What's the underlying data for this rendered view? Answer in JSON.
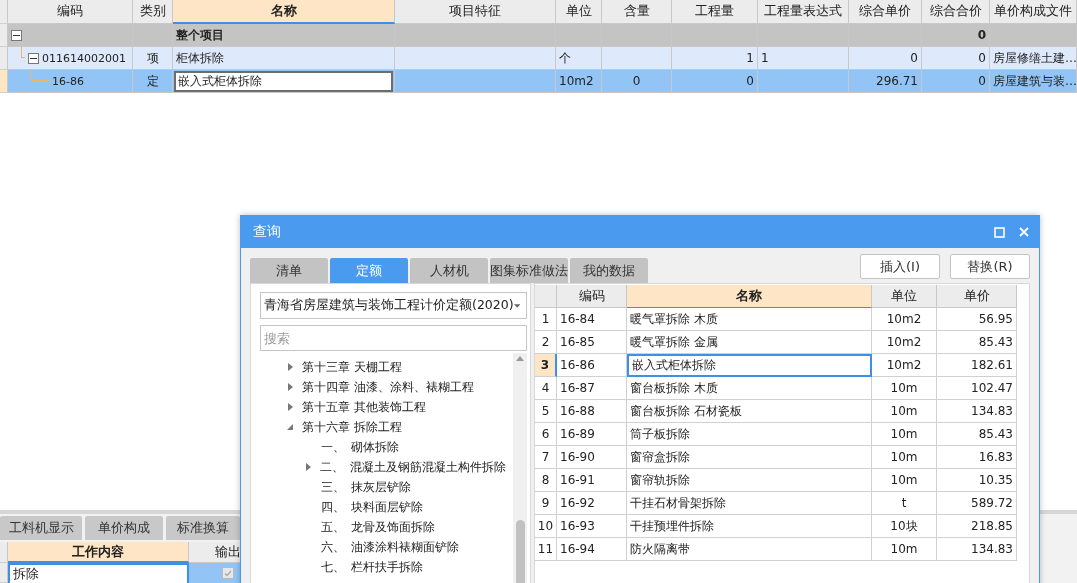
{
  "main_table": {
    "columns": [
      {
        "label": "编码",
        "selected": false
      },
      {
        "label": "类别",
        "selected": false
      },
      {
        "label": "名称",
        "selected": true
      },
      {
        "label": "项目特征",
        "selected": false
      },
      {
        "label": "单位",
        "selected": false
      },
      {
        "label": "含量",
        "selected": false
      },
      {
        "label": "工程量",
        "selected": false
      },
      {
        "label": "工程量表达式",
        "selected": false
      },
      {
        "label": "综合单价",
        "selected": false
      },
      {
        "label": "综合合价",
        "selected": false
      },
      {
        "label": "单价构成文件",
        "selected": false
      }
    ],
    "rows": [
      {
        "kind": "project",
        "expanded": true,
        "selected": false,
        "cells": [
          null,
          null,
          "整个项目",
          null,
          null,
          null,
          null,
          null,
          null,
          "0",
          null
        ],
        "children": [
          {
            "kind": "item",
            "expanded": true,
            "selected": false,
            "cells": [
              "011614002001",
              "项",
              "柜体拆除",
              null,
              "个",
              null,
              "1",
              "1",
              "0",
              "0",
              "房屋修缮土建…"
            ],
            "children": [
              {
                "kind": "quota",
                "selected": true,
                "cells": [
                  "16-86",
                  "定",
                  "嵌入式柜体拆除",
                  null,
                  "10m2",
                  "0",
                  "0",
                  null,
                  "296.71",
                  "0",
                  "房屋建筑与装…"
                ]
              }
            ]
          }
        ]
      }
    ]
  },
  "bottom_panel": {
    "tabs": [
      {
        "label": "工料机显示"
      },
      {
        "label": "单价构成"
      },
      {
        "label": "标准换算"
      }
    ],
    "columns": [
      {
        "label": "工作内容",
        "selected": true
      },
      {
        "label": "输出",
        "selected": false
      }
    ],
    "rows": [
      {
        "content": "拆除",
        "checked": true
      }
    ]
  },
  "dialog": {
    "title": "查询",
    "tabs": [
      {
        "label": "清单",
        "selected": false
      },
      {
        "label": "定额",
        "selected": true
      },
      {
        "label": "人材机",
        "selected": false
      },
      {
        "label": "图集标准做法",
        "selected": false
      },
      {
        "label": "我的数据",
        "selected": false
      }
    ],
    "buttons": [
      "插入(I)",
      "替换(R)"
    ],
    "library": {
      "value": "青海省房屋建筑与装饰工程计价定额(2020)"
    },
    "search": {
      "placeholder": "搜索"
    },
    "tree": [
      {
        "label": "第十三章 天棚工程",
        "expanded": false
      },
      {
        "label": "第十四章 油漆、涂料、裱糊工程",
        "expanded": false
      },
      {
        "label": "第十五章 其他装饰工程",
        "expanded": false
      },
      {
        "label": "第十六章 拆除工程",
        "expanded": true,
        "children": [
          {
            "number": "一、",
            "label": "砌体拆除"
          },
          {
            "number": "二、",
            "label": "混凝土及钢筋混凝土构件拆除",
            "expanded": false
          },
          {
            "number": "三、",
            "label": "抹灰层铲除"
          },
          {
            "number": "四、",
            "label": "块料面层铲除"
          },
          {
            "number": "五、",
            "label": "龙骨及饰面拆除"
          },
          {
            "number": "六、",
            "label": "油漆涂料裱糊面铲除"
          },
          {
            "number": "七、",
            "label": "栏杆扶手拆除"
          }
        ]
      }
    ],
    "results": {
      "columns": [
        {
          "label": "编码",
          "selected": false
        },
        {
          "label": "名称",
          "selected": true
        },
        {
          "label": "单位",
          "selected": false
        },
        {
          "label": "单价",
          "selected": false
        }
      ],
      "rows": [
        {
          "index": "1",
          "code": "16-84",
          "name": "暖气罩拆除 木质",
          "unit": "10m2",
          "price": "56.95",
          "selected": false
        },
        {
          "index": "2",
          "code": "16-85",
          "name": "暖气罩拆除 金属",
          "unit": "10m2",
          "price": "85.43",
          "selected": false
        },
        {
          "index": "3",
          "code": "16-86",
          "name": "嵌入式柜体拆除",
          "unit": "10m2",
          "price": "182.61",
          "selected": true
        },
        {
          "index": "4",
          "code": "16-87",
          "name": "窗台板拆除 木质",
          "unit": "10m",
          "price": "102.47",
          "selected": false
        },
        {
          "index": "5",
          "code": "16-88",
          "name": "窗台板拆除 石材瓷板",
          "unit": "10m",
          "price": "134.83",
          "selected": false
        },
        {
          "index": "6",
          "code": "16-89",
          "name": "筒子板拆除",
          "unit": "10m",
          "price": "85.43",
          "selected": false
        },
        {
          "index": "7",
          "code": "16-90",
          "name": "窗帘盒拆除",
          "unit": "10m",
          "price": "16.83",
          "selected": false
        },
        {
          "index": "8",
          "code": "16-91",
          "name": "窗帘轨拆除",
          "unit": "10m",
          "price": "10.35",
          "selected": false
        },
        {
          "index": "9",
          "code": "16-92",
          "name": "干挂石材骨架拆除",
          "unit": "t",
          "price": "589.72",
          "selected": false
        },
        {
          "index": "10",
          "code": "16-93",
          "name": "干挂预埋件拆除",
          "unit": "10块",
          "price": "218.85",
          "selected": false
        },
        {
          "index": "11",
          "code": "16-94",
          "name": "防火隔离带",
          "unit": "10m",
          "price": "134.83",
          "selected": false
        }
      ]
    }
  }
}
